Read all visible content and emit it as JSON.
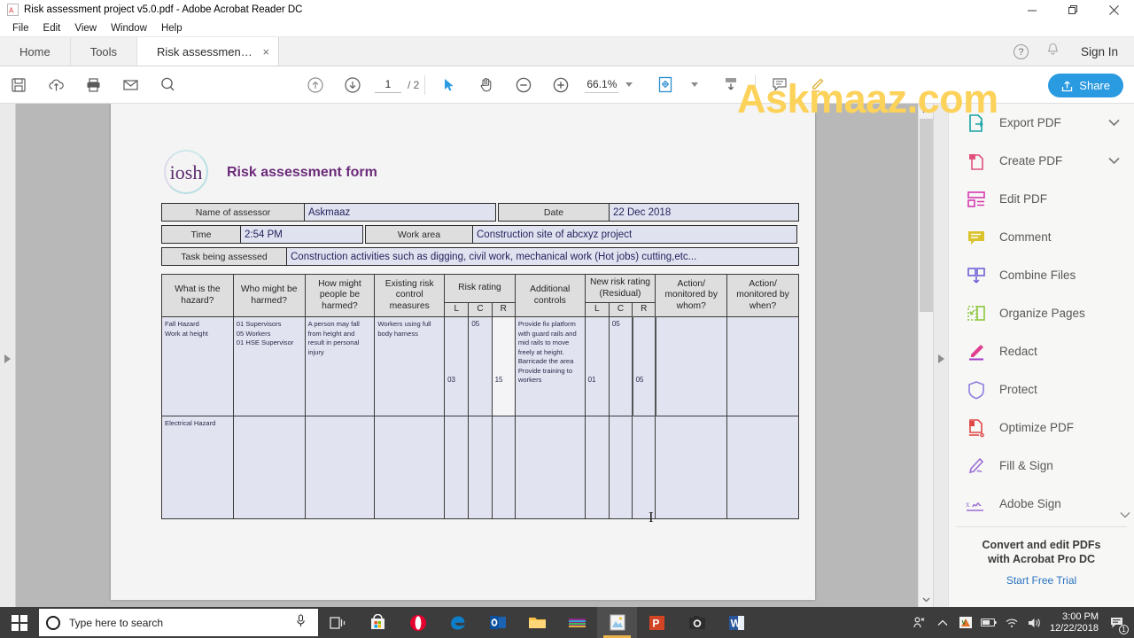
{
  "window": {
    "title": "Risk assessment project v5.0.pdf - Adobe Acrobat Reader DC",
    "doc_icon": "pdf-file-icon",
    "minimize": "minimize-icon",
    "restore": "restore-icon",
    "close": "close-icon"
  },
  "menu": {
    "items": [
      "File",
      "Edit",
      "View",
      "Window",
      "Help"
    ]
  },
  "tabs": {
    "home": "Home",
    "tools": "Tools",
    "document": "Risk assessment pr...",
    "close_glyph": "×",
    "help_glyph": "?",
    "bell_icon": "bell-icon",
    "sign_in": "Sign In"
  },
  "toolbar": {
    "icons": [
      "save-icon",
      "upload-cloud-icon",
      "print-icon",
      "email-icon",
      "zoom-search-icon"
    ],
    "prev_page": "arrow-up-circle-icon",
    "next_page": "arrow-down-circle-icon",
    "page_current": "1",
    "page_total": "/ 2",
    "select_tool": "cursor-arrow-icon",
    "hand_tool": "hand-icon",
    "zoom_out": "zoom-out-icon",
    "zoom_in": "zoom-in-icon",
    "zoom_level": "66.1%",
    "fit_page": "fit-page-icon",
    "scroll_mode": "scroll-mode-icon",
    "comment": "comment-icon",
    "highlight": "highlighter-icon",
    "share_label": "Share",
    "share_color": "#2a9ae1"
  },
  "watermark": {
    "text": "Askmaaz.com",
    "color": "#fcd25a"
  },
  "document": {
    "logo_word": "iosh",
    "title": "Risk assessment form",
    "title_color": "#6c2a7a",
    "fields": [
      {
        "label": "Name of assessor",
        "value": "Askmaaz"
      },
      {
        "label": "Date",
        "value": "22 Dec 2018"
      },
      {
        "label": "Time",
        "value": "2:54 PM"
      },
      {
        "label": "Work area",
        "value": "Construction site of abcxyz project"
      },
      {
        "label": "Task being assessed",
        "value": "Construction activities such as digging, civil work, mechanical work (Hot jobs) cutting,etc..."
      }
    ],
    "table": {
      "headers": {
        "hazard": "What is the hazard?",
        "who": "Who might be harmed?",
        "how": "How might people be harmed?",
        "existing": "Existing risk control measures",
        "risk_rating": "Risk rating",
        "additional": "Additional controls",
        "new_risk_rating": "New risk rating (Residual)",
        "action_whom": "Action/ monitored by whom?",
        "action_when": "Action/ monitored by when?",
        "sub_l": "L",
        "sub_c": "C",
        "sub_r": "R"
      },
      "rows": [
        {
          "hazard": "Fall Hazard\nWork at height",
          "who": "01 Supervisors\n05 Workers\n01 HSE Supervisor",
          "how": "A person may fall from height and result in personal injury",
          "existing": "Workers using full body harness",
          "risk_l": "03",
          "risk_c": "05",
          "risk_r": "15",
          "additional": "Provide fix platform with guard rails and mid rails to move freely at height.\nBarricade the area\nProvide training to workers",
          "new_l": "01",
          "new_c": "05",
          "new_r": "05",
          "action_whom": "",
          "action_when": ""
        },
        {
          "hazard": "Electrical Hazard",
          "who": "",
          "how": "",
          "existing": "",
          "risk_l": "",
          "risk_c": "",
          "risk_r": "",
          "additional": "",
          "new_l": "",
          "new_c": "",
          "new_r": "",
          "action_whom": "",
          "action_when": ""
        }
      ]
    }
  },
  "right_panel": {
    "tools": [
      {
        "label": "Export PDF",
        "icon": "export-pdf-icon",
        "chevron": true
      },
      {
        "label": "Create PDF",
        "icon": "create-pdf-icon",
        "chevron": true
      },
      {
        "label": "Edit PDF",
        "icon": "edit-pdf-icon",
        "chevron": false
      },
      {
        "label": "Comment",
        "icon": "comment-icon",
        "chevron": false
      },
      {
        "label": "Combine Files",
        "icon": "combine-files-icon",
        "chevron": false
      },
      {
        "label": "Organize Pages",
        "icon": "organize-pages-icon",
        "chevron": false
      },
      {
        "label": "Redact",
        "icon": "redact-icon",
        "chevron": false
      },
      {
        "label": "Protect",
        "icon": "protect-shield-icon",
        "chevron": false
      },
      {
        "label": "Optimize PDF",
        "icon": "optimize-pdf-icon",
        "chevron": false
      },
      {
        "label": "Fill & Sign",
        "icon": "fill-and-sign-icon",
        "chevron": false
      },
      {
        "label": "Adobe Sign",
        "icon": "adobe-sign-icon",
        "chevron": false
      }
    ],
    "promo_line1": "Convert and edit PDFs",
    "promo_line2": "with Acrobat Pro DC",
    "promo_cta": "Start Free Trial"
  },
  "taskbar": {
    "start_icon": "windows-start-icon",
    "search_placeholder": "Type here to search",
    "mic_icon": "microphone-icon",
    "apps": [
      "task-view-icon",
      "microsoft-store-icon",
      "opera-icon",
      "edge-icon",
      "outlook-icon",
      "file-explorer-icon",
      "winrar-icon",
      "photos-icon",
      "powerpoint-icon",
      "camera-icon",
      "word-icon"
    ],
    "tray": [
      "people-icon",
      "show-hidden-icons-chevron",
      "vlc-icon",
      "battery-icon",
      "wifi-icon",
      "volume-icon"
    ],
    "time": "3:00 PM",
    "date": "12/22/2018",
    "notification_icon": "action-center-icon",
    "notification_count": "1"
  }
}
